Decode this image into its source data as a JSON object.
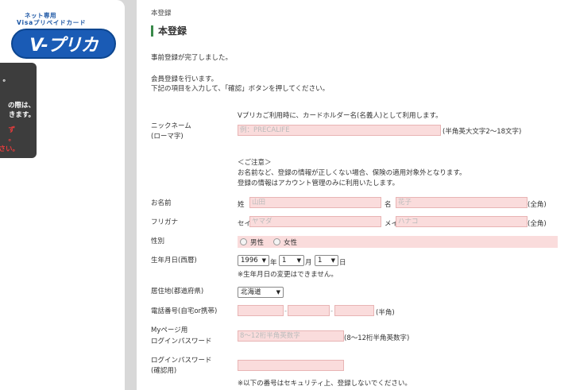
{
  "sidebar": {
    "logo": {
      "tagline1": "ネット専用",
      "tagline2": "Visaプリペイドカード",
      "name": "V-プリカ"
    },
    "notice_lines": [
      "。",
      "の際は、",
      "きます。",
      "ず",
      "。",
      "さい。"
    ]
  },
  "main": {
    "breadcrumb": "本登録",
    "title": "本登録",
    "intro1": "事前登録が完了しました。",
    "intro2": "会員登録を行います。",
    "intro3": "下記の項目を入力して、「確認」ボタンを押してください。",
    "nickname_note": "Vプリカご利用時に、カードホルダー名(名義人)として利用します。",
    "nickname_label1": "ニックネーム",
    "nickname_label2": "(ローマ字)",
    "nickname_placeholder": "例：PRECALIFE",
    "nickname_hint": "(半角英大文字2〜18文字)",
    "caution_title": "＜ご注意＞",
    "caution1": "お名前など、登録の情報が正しくない場合、保険の適用対象外となります。",
    "caution2": "登録の情報はアカウント管理のみに利用いたします。",
    "name_label": "お名前",
    "sei_label": "姓",
    "sei_placeholder": "山田",
    "mei_label": "名",
    "mei_placeholder": "花子",
    "zenkaku": "(全角)",
    "kana_label": "フリガナ",
    "sei_kana_label": "セイ",
    "sei_kana_placeholder": "ヤマダ",
    "mei_kana_label": "メイ",
    "mei_kana_placeholder": "ハナコ",
    "gender_label": "性別",
    "gender_male": "男性",
    "gender_female": "女性",
    "birth_label": "生年月日(西暦)",
    "birth_year": "1996",
    "year_unit": "年",
    "birth_month": "1",
    "month_unit": "月",
    "birth_day": "1",
    "day_unit": "日",
    "birth_note": "※生年月日の変更はできません。",
    "pref_label": "居住地(都道府県)",
    "pref_value": "北海道",
    "phone_label": "電話番号(自宅or携帯)",
    "phone_dash": "-",
    "phone_hint": "(半角)",
    "pw_label1": "Myページ用",
    "pw_label2": "ログインパスワード",
    "pw_placeholder": "8〜12桁半角英数字",
    "pw_hint": "(8〜12桁半角英数字)",
    "pw_confirm_label1": "ログインパスワード",
    "pw_confirm_label2": "(確認用)",
    "pw_note": "※以下の番号はセキュリティ上、登録しないでください。"
  }
}
